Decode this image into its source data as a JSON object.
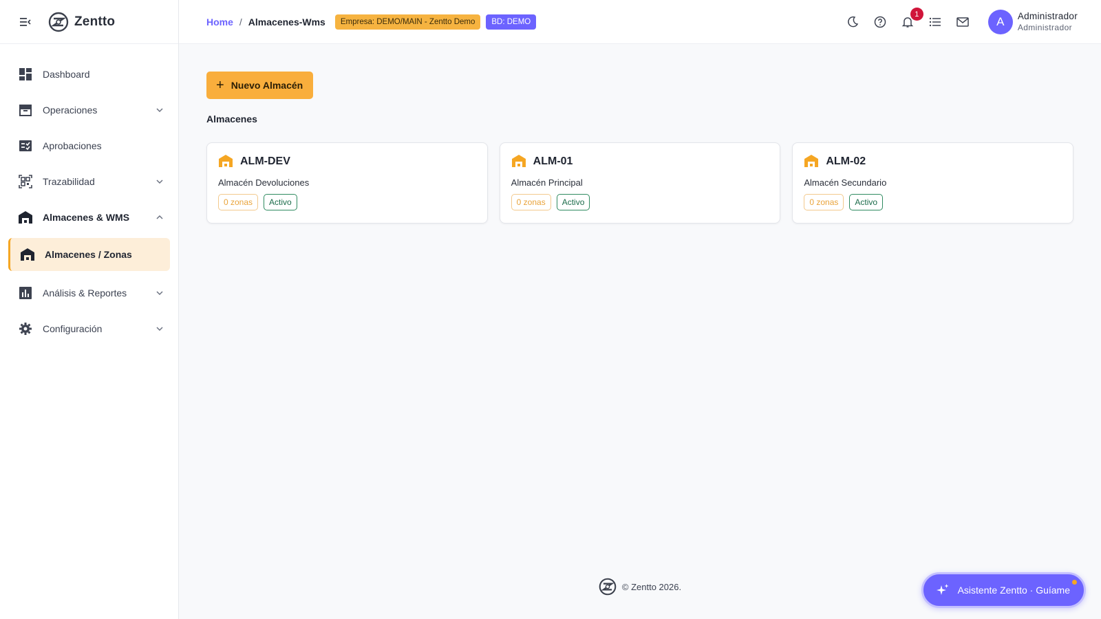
{
  "brand": {
    "name": "Zentto"
  },
  "sidebar": {
    "items": [
      {
        "label": "Dashboard"
      },
      {
        "label": "Operaciones"
      },
      {
        "label": "Aprobaciones"
      },
      {
        "label": "Trazabilidad"
      },
      {
        "label": "Almacenes & WMS"
      },
      {
        "label": "Almacenes / Zonas"
      },
      {
        "label": "Análisis & Reportes"
      },
      {
        "label": "Configuración"
      }
    ]
  },
  "header": {
    "breadcrumb_home": "Home",
    "breadcrumb_sep": "/",
    "breadcrumb_current": "Almacenes-Wms",
    "empresa_chip": "Empresa: DEMO/MAIN - Zentto Demo",
    "bd_chip": "BD: DEMO",
    "notifications_count": "1",
    "avatar_initial": "A",
    "user_name": "Administrador",
    "user_role": "Administrador"
  },
  "main": {
    "new_button": "Nuevo Almacén",
    "section_title": "Almacenes",
    "cards": [
      {
        "code": "ALM-DEV",
        "name": "Almacén Devoluciones",
        "zones": "0 zonas",
        "status": "Activo"
      },
      {
        "code": "ALM-01",
        "name": "Almacén Principal",
        "zones": "0 zonas",
        "status": "Activo"
      },
      {
        "code": "ALM-02",
        "name": "Almacén Secundario",
        "zones": "0 zonas",
        "status": "Activo"
      }
    ]
  },
  "footer": {
    "text": "© Zentto 2026."
  },
  "assistant": {
    "label": "Asistente Zentto · Guíame"
  },
  "colors": {
    "accent": "#6c63ff",
    "primary_orange": "#f9ae3c",
    "active_bg": "#fdeed9",
    "badge_red": "#d0153a",
    "active_status": "#1b6b4a"
  }
}
